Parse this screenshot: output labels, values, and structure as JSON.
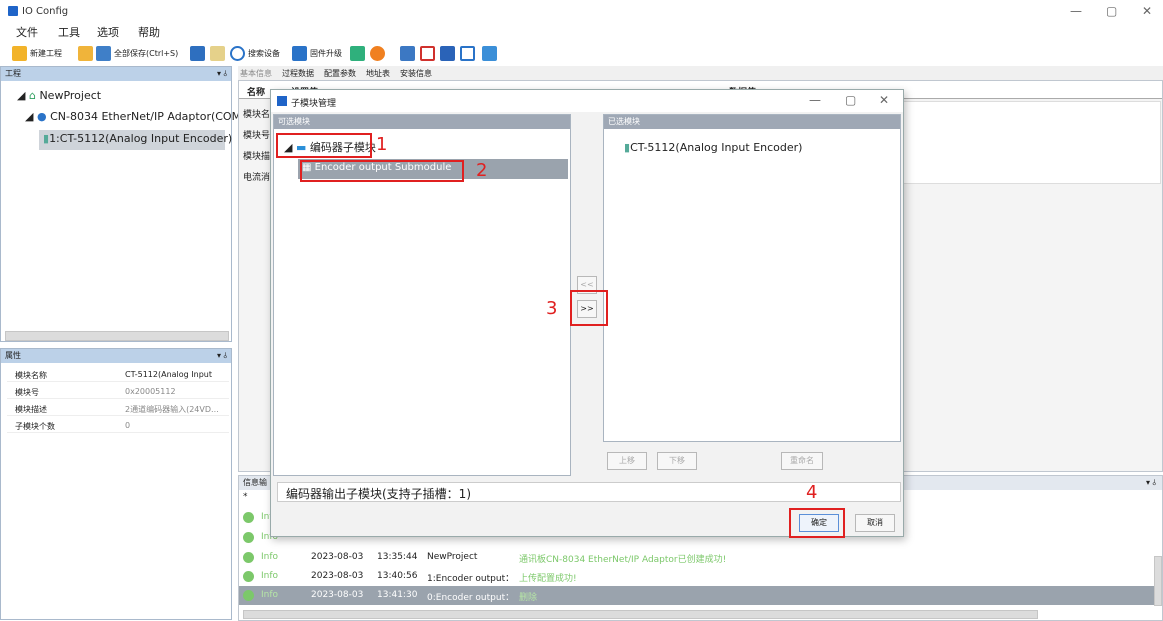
{
  "window": {
    "title": "IO Config"
  },
  "menu": [
    "文件",
    "工具",
    "选项",
    "帮助"
  ],
  "toolbar": {
    "new_project": "新建工程",
    "save_all": "全部保存(Ctrl+S)",
    "search_device": "搜索设备",
    "firmware_upgrade": "固件升级"
  },
  "project_panel": {
    "title": "工程",
    "pin": "▾ ⫰",
    "root": "NewProject",
    "adapter": "CN-8034 EtherNet/IP Adaptor(COM",
    "module": "1:CT-5112(Analog Input Encoder)"
  },
  "property_panel": {
    "title": "属性",
    "rows": [
      {
        "key": "模块名称",
        "value": "CT-5112(Analog Input"
      },
      {
        "key": "模块号",
        "value": "0x20005112"
      },
      {
        "key": "模块描述",
        "value": "2通道编码器输入(24VD..."
      },
      {
        "key": "子模块个数",
        "value": "0"
      }
    ]
  },
  "main_tabs": [
    "基本信息",
    "过程数据",
    "配置参数",
    "地址表",
    "安装信息"
  ],
  "grid": {
    "col_name": "名称",
    "col_set": "设置值",
    "col_data": "数据值",
    "rows": [
      "模块名",
      "模块号",
      "模块描",
      "电流消"
    ]
  },
  "info_panel": {
    "title": "信息输",
    "filter": "*",
    "logs": [
      {
        "level": "Info",
        "date": "",
        "time": "",
        "source": "",
        "message": ""
      },
      {
        "level": "Info",
        "date": "",
        "time": "",
        "source": "",
        "message": ""
      },
      {
        "level": "Info",
        "date": "2023-08-03",
        "time": "13:35:44",
        "source": "NewProject",
        "message": "通讯板CN-8034 EtherNet/IP Adaptor已创建成功!"
      },
      {
        "level": "Info",
        "date": "2023-08-03",
        "time": "13:40:56",
        "source": "1:Encoder output：",
        "message": "上传配置成功!"
      },
      {
        "level": "Info",
        "date": "2023-08-03",
        "time": "13:41:30",
        "source": "0:Encoder output：",
        "message": "删除"
      }
    ]
  },
  "dialog": {
    "title": "子模块管理",
    "available_header": "可选模块",
    "selected_header": "已选模块",
    "available_group": "编码器子模块",
    "available_item": "Encoder output  Submodule",
    "selected_item": "CT-5112(Analog Input Encoder)",
    "move_left": "<<",
    "move_right": ">>",
    "move_up": "上移",
    "move_down": "下移",
    "rename": "重命名",
    "description": "编码器输出子模块(支持子插槽：1)",
    "ok": "确定",
    "cancel": "取消"
  },
  "annotations": [
    "1",
    "2",
    "3",
    "4"
  ],
  "colors": {
    "accent": "#1f64c8",
    "annotation": "#e02020",
    "info_green": "#7cc86a",
    "panel_header": "#bcd1e8"
  }
}
